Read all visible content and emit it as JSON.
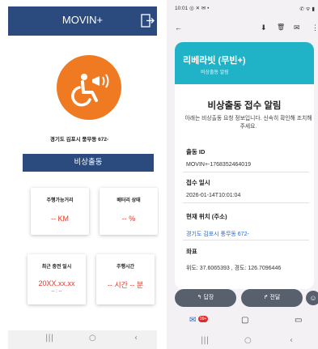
{
  "left": {
    "app_title": "MOVIN+",
    "address": "경기도 김포시 풍무동 672-",
    "emergency_label": "비상출동",
    "cards": [
      {
        "label": "주행가능거리",
        "value": "-- KM",
        "sub": ""
      },
      {
        "label": "배터리 상태",
        "value": "-- %",
        "sub": ""
      },
      {
        "label": "최근 충전 일시",
        "value": "20XX.xx.xx",
        "sub": "-- : --"
      },
      {
        "label": "주행시간",
        "value": "-- 시간 -- 분",
        "sub": ""
      }
    ],
    "nav": {
      "recent": "|||",
      "home": "○",
      "back": "‹"
    },
    "colors": {
      "primary": "#2b4b7e",
      "logo": "#f07a22",
      "value": "#e03a2a"
    },
    "logo_icon": "wheelchair-alert-icon"
  },
  "right": {
    "status": {
      "time": "10:01",
      "left_icons": "◎ ✕ ✉ •",
      "right_icons": "✆ ᯤ ▮"
    },
    "toolbar": {
      "back": "←",
      "save": "⬇",
      "delete": "🗑",
      "mail": "✉",
      "more": "⋮"
    },
    "sender": {
      "name": "리베라빗 (무빈+)",
      "subtitle": "비상출동 알림"
    },
    "mail_title": "비상출동 접수 알림",
    "mail_desc": "아래는 비상출동 요청 정보입니다. 신속히 확인해 조치해 주세요.",
    "fields": [
      {
        "label": "출동 ID",
        "value": "MOVIN+-1768352464019",
        "link": false
      },
      {
        "label": "접수 일시",
        "value": "2026-01-14T10:01:04",
        "link": false
      },
      {
        "label": "현재 위치 (주소)",
        "value": "경기도 김포시 풍무동 672-",
        "link": true
      },
      {
        "label": "좌표",
        "value": "위도: 37.6065393 , 경도: 126.7096446",
        "link": false
      }
    ],
    "actions": {
      "reply": "답장",
      "forward": "전달",
      "reply_icon": "↰",
      "forward_icon": "↱",
      "emoji": "☺"
    },
    "bottom_nav": {
      "mail_badge": "99+",
      "mail": "✉",
      "chat": "▢",
      "video": "▭"
    },
    "nav": {
      "recent": "|||",
      "home": "○",
      "back": "‹"
    },
    "colors": {
      "banner": "#20b3c8",
      "button": "#58606d",
      "link": "#2a64c8",
      "badge": "#e02a2a"
    }
  }
}
